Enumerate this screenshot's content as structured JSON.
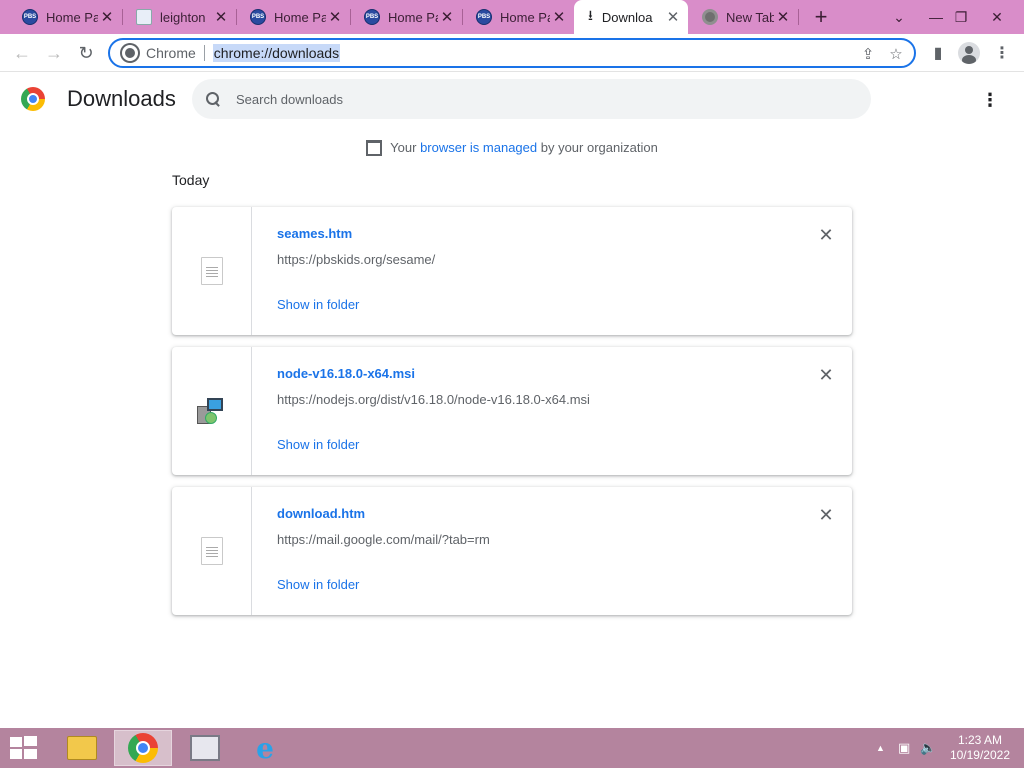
{
  "tabs": [
    {
      "title": "Home Pa",
      "favicon": "pbs-icon",
      "active": false
    },
    {
      "title": "leighton",
      "favicon": "document-icon",
      "active": false
    },
    {
      "title": "Home Pa",
      "favicon": "pbs-icon",
      "active": false
    },
    {
      "title": "Home Pa",
      "favicon": "pbs-icon",
      "active": false
    },
    {
      "title": "Home Pa",
      "favicon": "pbs-icon",
      "active": false
    },
    {
      "title": "Downloa",
      "favicon": "download-icon",
      "active": true
    },
    {
      "title": "New Tab",
      "favicon": "chrome-icon",
      "active": false
    }
  ],
  "tab_favicon_text": "PBS",
  "omnibox": {
    "chip": "Chrome",
    "url": "chrome://downloads"
  },
  "page": {
    "title": "Downloads",
    "search_placeholder": "Search downloads",
    "managed_prefix": "Your ",
    "managed_link": "browser is managed",
    "managed_suffix": " by your organization",
    "section": "Today"
  },
  "downloads": [
    {
      "name": "seames.htm",
      "url": "https://pbskids.org/sesame/",
      "action": "Show in folder",
      "icon": "html-file-icon"
    },
    {
      "name": "node-v16.18.0-x64.msi",
      "url": "https://nodejs.org/dist/v16.18.0/node-v16.18.0-x64.msi",
      "action": "Show in folder",
      "icon": "installer-icon"
    },
    {
      "name": "download.htm",
      "url": "https://mail.google.com/mail/?tab=rm",
      "action": "Show in folder",
      "icon": "html-file-icon"
    }
  ],
  "taskbar": {
    "time": "1:23 AM",
    "date": "10/19/2022"
  },
  "colors": {
    "accent": "#1a73e8",
    "tabstrip": "#d98dc9",
    "taskbar": "#b4849e"
  }
}
